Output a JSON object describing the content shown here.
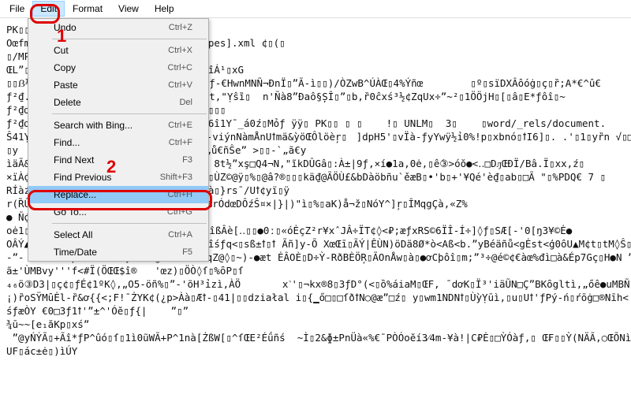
{
  "menubar": {
    "file": "File",
    "edit": "Edit",
    "format": "Format",
    "view": "View",
    "help": "Help"
  },
  "edit_menu": {
    "undo": {
      "label": "Undo",
      "shortcut": "Ctrl+Z"
    },
    "cut": {
      "label": "Cut",
      "shortcut": "Ctrl+X"
    },
    "copy": {
      "label": "Copy",
      "shortcut": "Ctrl+C"
    },
    "paste": {
      "label": "Paste",
      "shortcut": "Ctrl+V"
    },
    "delete": {
      "label": "Delete",
      "shortcut": "Del"
    },
    "search_bing": {
      "label": "Search with Bing...",
      "shortcut": "Ctrl+E"
    },
    "find": {
      "label": "Find...",
      "shortcut": "Ctrl+F"
    },
    "find_next": {
      "label": "Find Next",
      "shortcut": "F3"
    },
    "find_previous": {
      "label": "Find Previous",
      "shortcut": "Shift+F3"
    },
    "replace": {
      "label": "Replace...",
      "shortcut": "Ctrl+H"
    },
    "goto": {
      "label": "Go To...",
      "shortcut": "Ctrl+G"
    },
    "select_all": {
      "label": "Select All",
      "shortcut": "Ctrl+A"
    },
    "time_date": {
      "label": "Time/Date",
      "shortcut": "F5"
    }
  },
  "annotations": {
    "one": "1",
    "two": "2"
  },
  "document_text": "PK▯▯▯▯\nOœfmWZ▯▯▯▯▯▯▯▯▯▯▯▯▯▯▯▯▯▯▯▯▯▯▯[t_Types].xml ¢▯(▯\n▯/MP-â▯▯▯▯\nŒLˮ▯▯▯▯▯▯▯▯▯▯▯▯▯▯▯▯▯▯▯▯▯▯▯▯▯▯%K(H¹îÁ¹▯xG\n▯▯ẞ½-                       ▯▯Òź▯¢ƒ-€HwnMNÑ¬ĐnÏ▯ˮÃ-ì▯▯)/ÒZwB^ÚÀŒ▯4%Ýñœ        ▯º▯sïDXÂôóġ▯ç▯ȑ;A*€^û€\nƒ²₫.                        ȑ€#î]ẞt,\"Ỵŝȉ▯  n'Ñà8ˮĐaô§ȘÎ▯ˮ▯b,ȑ0ĉxś³½¢ZqUx÷ˮ~²▯1ÖÖjH▯[▯â▯E*ƒôî▯~\nƒ²₫ơȑ▯ò '                   ▯▯▯▯▯▯▯▯▯\nƒ²₫ơȑ▯ò▯; ' ●               ▯çŚæ▯?6î1Y¯_á0ź▯Mỏƒ ÿÿ▯ PK▯▯ ▯ ▯    !▯ UNLM▯  3▯    ▯word/_rels/document.\nŜ41Ỵ,ơă▯ÿ.                  BMĐUꝉ▯-viýnNàmÅnUꝉmä&ỳöŒÔlöèŗ▯ㅤ]dpH5'▯vÏà-ƒyYwÿ½ỉ0%!p▯xbnó▯ꝉI6]▯. .'▯1▯yȑn √▯□]#07ç(\n▯yㅤÇ▯ơ▯f,I -                 ▯æ▯>„ů€ñŜeˮ >▯▯-`„ã€y\nìäÃ&śő▯Œú. û               □ź&▯`s  8t½ˮxş□Q4¬N,\"ĩkDÛGâ▯:À±|9ƒ,×í●1a,0ė,▯ế③>óŏ●<‥□DԓŒĐÏ/Bâ.Ï▯xx,ź▯\n×ïÀ₫ơĄ×▯>{f/▯ơ.             ▯x▯▯ôû▯ÙZ©@ÿ▯%▯@â?®▯▯▯kä₫@ÃÖÙ£&bDàöbñu`ěæB▯•'b▯+'¥Qé'è₫▯ab▯□Ã \"▯%PDQ€ 7 ▯\nRÍàź▯³ơp▯□▯ơ… 'e            ▯▯ˮȏ°)à▯}rs¯/Uꝉ¢yï▯ÿ\nr(ȐÛW▯▯/□âMnUꝉƒó'øØjPeoAYûLà?œl▯c▯%rÓdœDÔźŜ¤×|}|)\"ì▯%▯aK)å¬ž▯NóY^]ŗ▯ÎMqgÇà,«Z%\n● Ñ₫ſ¶▯ɡ,b▯▯-\noė1▯  \\Ǥ▯●ƒ●▯ ®▯₫,b▯▯▯0º6@5}{(FèZĒîßÂè[‥▯▯●0ː▯«óĖçZ²r¥xˆJÂ÷ÏT¢◊<₽;æƒxRS©6ÏÎ-Í÷]◊ƒ▯SÆ[-'0[ŋ3¥©Ė●\nOÂÝ▲xÀZ▼ȑfƒAUŹ13,\"ŏ,▯' i▯' =/▯s▯ƒöîśƒq<▯sß±ꝉ▯ꝉ Ãñ]y-Õ XœŒī▯ÃÝ|ÊÙN)öDä8Ø*ò<Aß<b.ˮyBéäñů<gĖst<ģ0ôU▲M¢t▯tM◊Ŝ▯\n-ˮ- -ˮ▯ȐÎÛJþ³tuDŎk÷ơƒkºWkgˮ©=-f0ꝉ3qZ@◊▯~)-●æt ĖÂOÈ▯D÷Ỳ-RðBÈÖŖ▯ÃOnÅw▯à▯●ơCþôî▯m;ˮ³÷@é©¢€àœ%đì□à&Ép7Gç▯H●N ˮ\nã±'ÙMBvy'''f<#Ï(ÖŒŒ$î®   'œz)▯ÖÒ◊ſ▯%ȏP▯ſ\n₄₆ö③D3|▯ç¢▯ƒÉ¢1ºK◊,„O5-öñ%▯ˮ-'õH³ỉzì,ÀÖ       x˺'▯¬kx®8▯3ƒD°(<▯ȍ%áiaM▯ŒF, ¯dơK▯Ï³'iäŨN□ÇˮBKȏgltì,„őê●uMBÑ▯ő③\n¡)ȑoSŸMȗĖl-ȑ&ơ{{<;F!¯ŻYK¢(¿p>Àà▯Æꝉ-▯41|▯▯działal i▯{▁ő□▯□ſðꝉN○@æˮ□ź▯ y▯wm1NDNꝉ▯ÙỳỴūì,▯u▯Uꝉ'ƒPý-ń▯ŕōġ□®Nīh<└Z®▯>ç6ý▯ À▯\nśƒæÒY €0□3ƒ1ꝉ'ˮ±^'Óĕ▯ƒ{|    ˮ▯ˮ\n¾ū~~[e₁ăKp▯xśˮ\n ˮ@yŃÝÃ▯+Ãî*ƒP^ûó▯ſ▯1ì0ũWÃ+P^1nà[ŻßW[▯^ſŒE²Éǘñś  ~Ì▯2&ɸ±PnÜà«%€¯PÒÓoĕí3⁄4m-¥à!|C₽Ė▯□ỲÓàƒ,▯ Œ₣▯▯Ỳ(NÄÃ,○ŒÕNìÒ▯\nUF▯ác±ė▯)ìÚY"
}
